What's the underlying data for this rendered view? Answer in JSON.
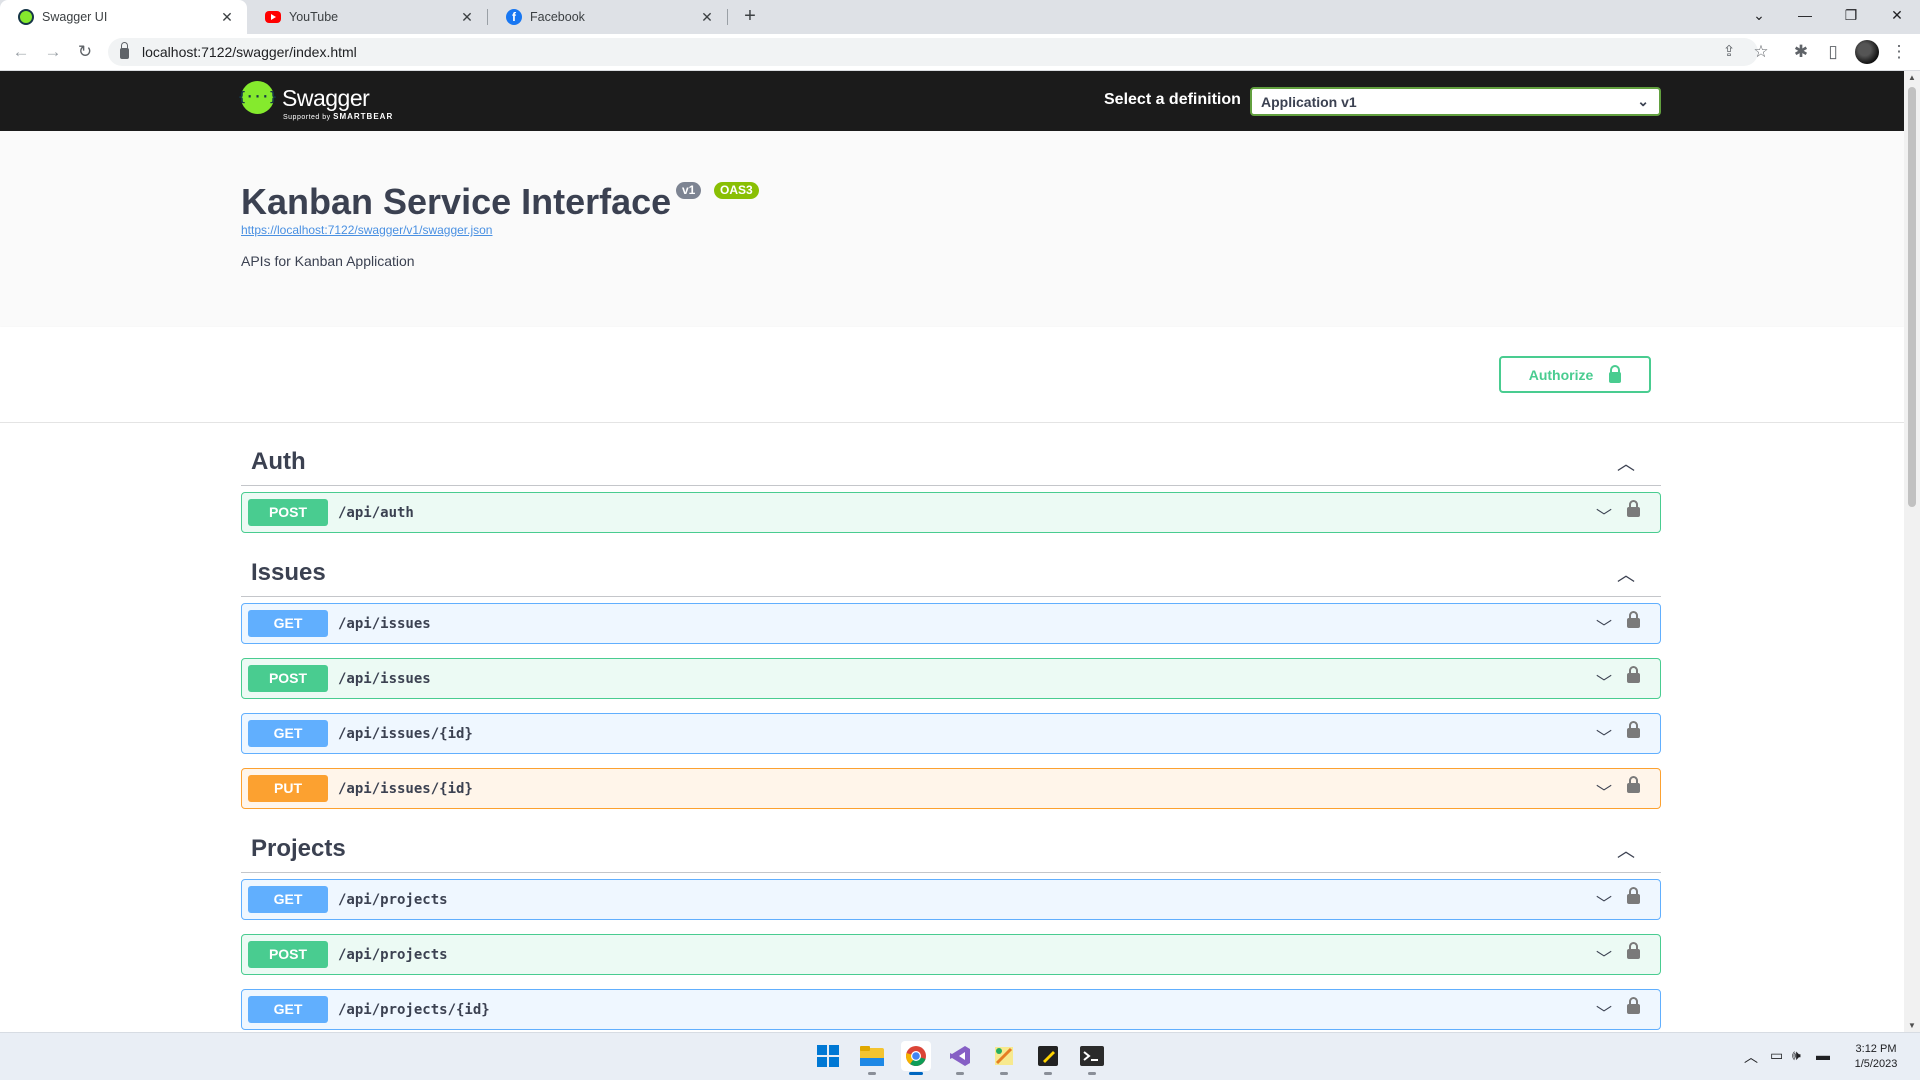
{
  "browser": {
    "tabs": [
      {
        "title": "Swagger UI",
        "icon": "swagger-favicon-icon",
        "active": true
      },
      {
        "title": "YouTube",
        "icon": "youtube-favicon-icon",
        "active": false
      },
      {
        "title": "Facebook",
        "icon": "facebook-favicon-icon",
        "active": false
      }
    ],
    "url": "localhost:7122/swagger/index.html"
  },
  "swagger": {
    "logo_text": "Swagger",
    "logo_glyph": "{···}",
    "logo_sub": "Supported by",
    "logo_sub_brand": "SMARTBEAR",
    "definition_label": "Select a definition",
    "definition_selected": "Application v1",
    "title": "Kanban Service Interface",
    "version_badge": "v1",
    "oas_badge": "OAS3",
    "spec_url": "https://localhost:7122/swagger/v1/swagger.json",
    "description": "APIs for Kanban Application",
    "authorize_label": "Authorize",
    "colors": {
      "get": "#61affe",
      "post": "#49cc90",
      "put": "#fca130",
      "topbar": "#1b1b1b",
      "accent": "#85ea2d"
    }
  },
  "tags": [
    {
      "name": "Auth",
      "ops": [
        {
          "method": "POST",
          "path": "/api/auth"
        }
      ]
    },
    {
      "name": "Issues",
      "ops": [
        {
          "method": "GET",
          "path": "/api/issues"
        },
        {
          "method": "POST",
          "path": "/api/issues"
        },
        {
          "method": "GET",
          "path": "/api/issues/{id}"
        },
        {
          "method": "PUT",
          "path": "/api/issues/{id}"
        }
      ]
    },
    {
      "name": "Projects",
      "ops": [
        {
          "method": "GET",
          "path": "/api/projects"
        },
        {
          "method": "POST",
          "path": "/api/projects"
        },
        {
          "method": "GET",
          "path": "/api/projects/{id}"
        }
      ]
    }
  ],
  "taskbar": {
    "apps": [
      "start-icon",
      "file-explorer-icon",
      "chrome-icon",
      "visual-studio-icon",
      "sketch-app-icon",
      "sticky-notes-icon",
      "terminal-icon"
    ],
    "time": "3:12 PM",
    "date": "1/5/2023"
  }
}
